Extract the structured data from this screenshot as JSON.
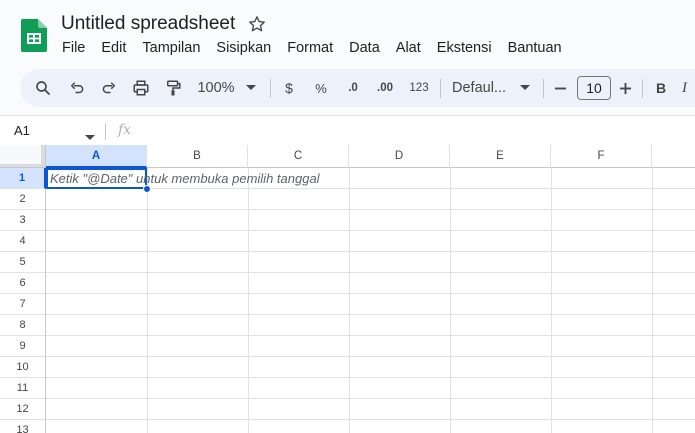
{
  "doc": {
    "title": "Untitled spreadsheet",
    "brand_color": "#0f9d58"
  },
  "menu": [
    "File",
    "Edit",
    "Tampilan",
    "Sisipkan",
    "Format",
    "Data",
    "Alat",
    "Ekstensi",
    "Bantuan"
  ],
  "toolbar": {
    "zoom": "100%",
    "currency": "$",
    "percent": "%",
    "decrease_decimal": ".0",
    "increase_decimal": ".00",
    "number_format": "123",
    "font": "Defaul...",
    "font_size": "10",
    "bold": "B",
    "italic": "I",
    "icons": [
      "search-icon",
      "undo-icon",
      "redo-icon",
      "print-icon",
      "paint-format-icon",
      "dropdown-icon",
      "minus-icon",
      "plus-icon"
    ]
  },
  "formula_bar": {
    "cell_ref": "A1",
    "fx": "fx"
  },
  "grid": {
    "columns": [
      "A",
      "B",
      "C",
      "D",
      "E",
      "F"
    ],
    "rows": [
      "1",
      "2",
      "3",
      "4",
      "5",
      "6",
      "7",
      "8",
      "9",
      "10",
      "11",
      "12",
      "13"
    ],
    "selected_cell": "A1",
    "hint": "Ketik \"@Date\" untuk membuka pemilih tanggal",
    "accent": "#0b57d0"
  }
}
